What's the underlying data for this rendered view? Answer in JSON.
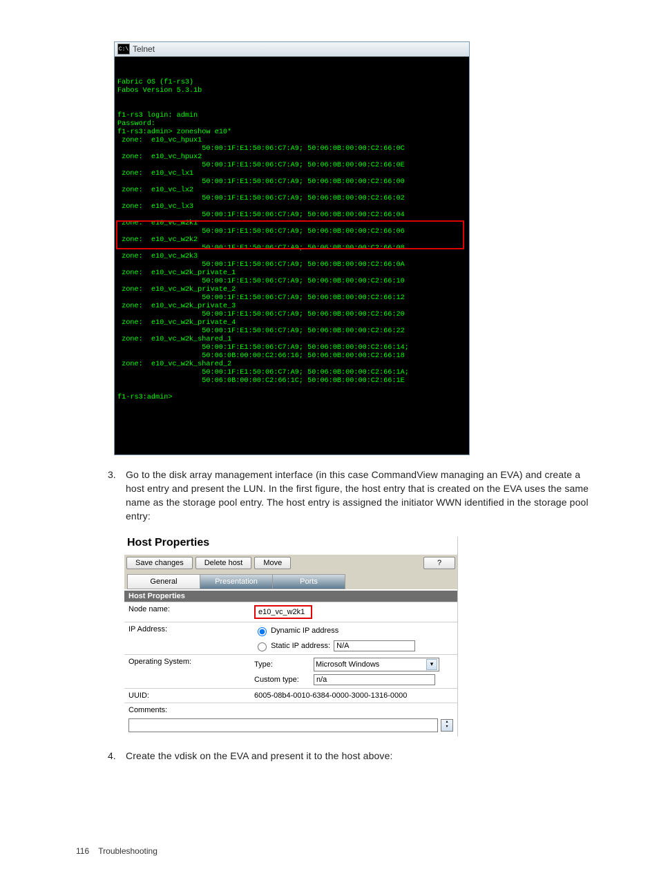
{
  "telnet": {
    "title": "Telnet",
    "body_text": "\n\nFabric OS (f1-rs3)\nFabos Version 5.3.1b\n\n\nf1-rs3 login: admin\nPassword:\nf1-rs3:admin> zoneshow e10*\n zone:  e10_vc_hpux1\n                    50:00:1F:E1:50:06:C7:A9; 50:06:0B:00:00:C2:66:0C\n zone:  e10_vc_hpux2\n                    50:00:1F:E1:50:06:C7:A9; 50:06:0B:00:00:C2:66:0E\n zone:  e10_vc_lx1\n                    50:00:1F:E1:50:06:C7:A9; 50:06:0B:00:00:C2:66:00\n zone:  e10_vc_lx2\n                    50:00:1F:E1:50:06:C7:A9; 50:06:0B:00:00:C2:66:02\n zone:  e10_vc_lx3\n                    50:00:1F:E1:50:06:C7:A9; 50:06:0B:00:00:C2:66:04\n zone:  e10_vc_w2k1\n                    50:00:1F:E1:50:06:C7:A9; 50:06:0B:00:00:C2:66:06\n zone:  e10_vc_w2k2\n                    50:00:1F:E1:50:06:C7:A9; 50:06:0B:00:00:C2:66:08\n zone:  e10_vc_w2k3\n                    50:00:1F:E1:50:06:C7:A9; 50:06:0B:00:00:C2:66:0A\n zone:  e10_vc_w2k_private_1\n                    50:00:1F:E1:50:06:C7:A9; 50:06:0B:00:00:C2:66:10\n zone:  e10_vc_w2k_private_2\n                    50:00:1F:E1:50:06:C7:A9; 50:06:0B:00:00:C2:66:12\n zone:  e10_vc_w2k_private_3\n                    50:00:1F:E1:50:06:C7:A9; 50:06:0B:00:00:C2:66:20\n zone:  e10_vc_w2k_private_4\n                    50:00:1F:E1:50:06:C7:A9; 50:06:0B:00:00:C2:66:22\n zone:  e10_vc_w2k_shared_1\n                    50:00:1F:E1:50:06:C7:A9; 50:06:0B:00:00:C2:66:14;\n                    50:06:0B:00:00:C2:66:16; 50:06:0B:00:00:C2:66:18\n zone:  e10_vc_w2k_shared_2\n                    50:00:1F:E1:50:06:C7:A9; 50:06:0B:00:00:C2:66:1A;\n                    50:06:0B:00:00:C2:66:1C; 50:06:0B:00:00:C2:66:1E\n\nf1-rs3:admin>"
  },
  "steps": {
    "three_num": "3.",
    "three_body": "Go to the disk array management interface (in this case CommandView managing an EVA) and create a host entry and present the LUN. In the first figure, the host entry that is created on the EVA uses the same name as the storage pool entry. The host entry is assigned the initiator WWN identified in the storage pool entry:",
    "four_num": "4.",
    "four_body": "Create the vdisk on the EVA and present it to the host above:"
  },
  "host": {
    "panel_title": "Host Properties",
    "toolbar": {
      "save": "Save changes",
      "delete": "Delete host",
      "move": "Move",
      "help": "?"
    },
    "tabs": {
      "general": "General",
      "presentation": "Presentation",
      "ports": "Ports"
    },
    "section_head": "Host Properties",
    "fields": {
      "node_name_label": "Node name:",
      "node_name_value": "e10_vc_w2k1",
      "ip_label": "IP Address:",
      "ip_dynamic": "Dynamic IP address",
      "ip_static": "Static IP address:",
      "ip_static_value": "N/A",
      "os_label": "Operating System:",
      "os_type_label": "Type:",
      "os_type_value": "Microsoft Windows",
      "os_custom_label": "Custom type:",
      "os_custom_value": "n/a",
      "uuid_label": "UUID:",
      "uuid_value": "6005-08b4-0010-6384-0000-3000-1316-0000",
      "comments_label": "Comments:"
    }
  },
  "footer": {
    "page_number": "116",
    "section": "Troubleshooting"
  }
}
